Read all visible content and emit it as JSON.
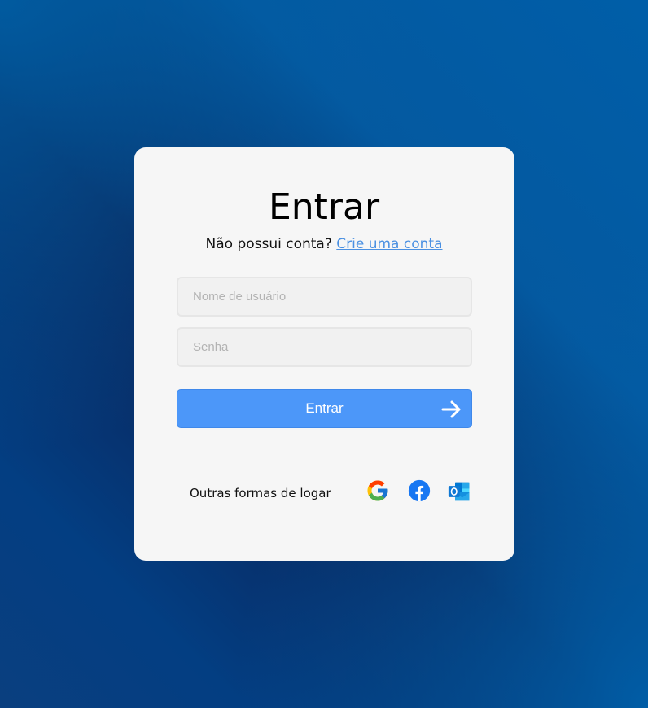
{
  "login": {
    "title": "Entrar",
    "no_account_text": "Não possui conta?",
    "create_account_link": "Crie uma conta",
    "username_placeholder": "Nome de usuário",
    "password_placeholder": "Senha",
    "submit_label": "Entrar",
    "other_methods_label": "Outras formas de logar",
    "social_icons": [
      "google-icon",
      "facebook-icon",
      "outlook-icon"
    ]
  },
  "colors": {
    "accent": "#4c97f9",
    "link": "#4a90e2",
    "card": "#f6f6f6",
    "background_dark": "#0b2357",
    "background_light": "#005ea8"
  }
}
